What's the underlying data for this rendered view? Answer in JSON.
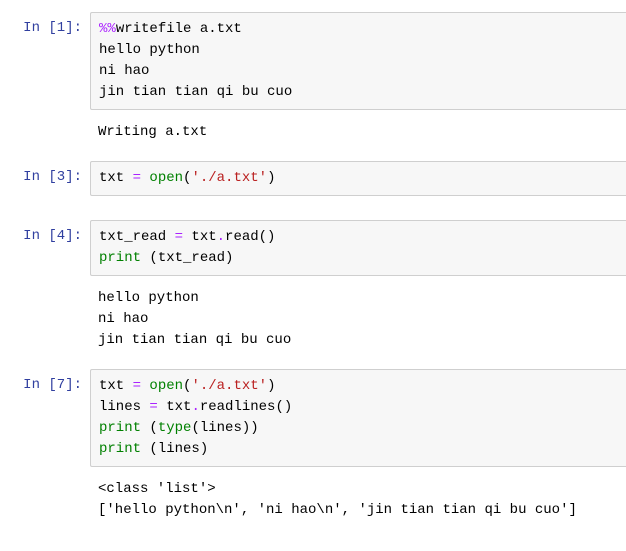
{
  "cells": [
    {
      "prompt_label": "In ",
      "prompt_num": "[1]:",
      "code": {
        "l0_magic": "%%",
        "l0_rest": "writefile a.txt",
        "l1": "hello python",
        "l2": "ni hao",
        "l3": "jin tian tian qi bu cuo"
      },
      "output": "Writing a.txt"
    },
    {
      "prompt_label": "In ",
      "prompt_num": "[3]:",
      "code": {
        "l0_a": "txt ",
        "l0_op": "=",
        "l0_b": " ",
        "l0_fn": "open",
        "l0_p1": "(",
        "l0_str": "'./a.txt'",
        "l0_p2": ")"
      }
    },
    {
      "prompt_label": "In ",
      "prompt_num": "[4]:",
      "code": {
        "l0_a": "txt_read ",
        "l0_op": "=",
        "l0_b": " txt",
        "l0_dot": ".",
        "l0_meth": "read()",
        "l1_fn": "print",
        "l1_rest": " (txt_read)"
      },
      "output": "hello python\nni hao\njin tian tian qi bu cuo"
    },
    {
      "prompt_label": "In ",
      "prompt_num": "[7]:",
      "code": {
        "l0_a": "txt ",
        "l0_op": "=",
        "l0_b": " ",
        "l0_fn": "open",
        "l0_p1": "(",
        "l0_str": "'./a.txt'",
        "l0_p2": ")",
        "l1_a": "lines ",
        "l1_op": "=",
        "l1_b": " txt",
        "l1_dot": ".",
        "l1_meth": "readlines()",
        "l2_fn": "print",
        "l2_p1": " (",
        "l2_type": "type",
        "l2_rest": "(lines))",
        "l3_fn": "print",
        "l3_rest": " (lines)"
      },
      "output": "<class 'list'>\n['hello python\\n', 'ni hao\\n', 'jin tian tian qi bu cuo']"
    }
  ]
}
